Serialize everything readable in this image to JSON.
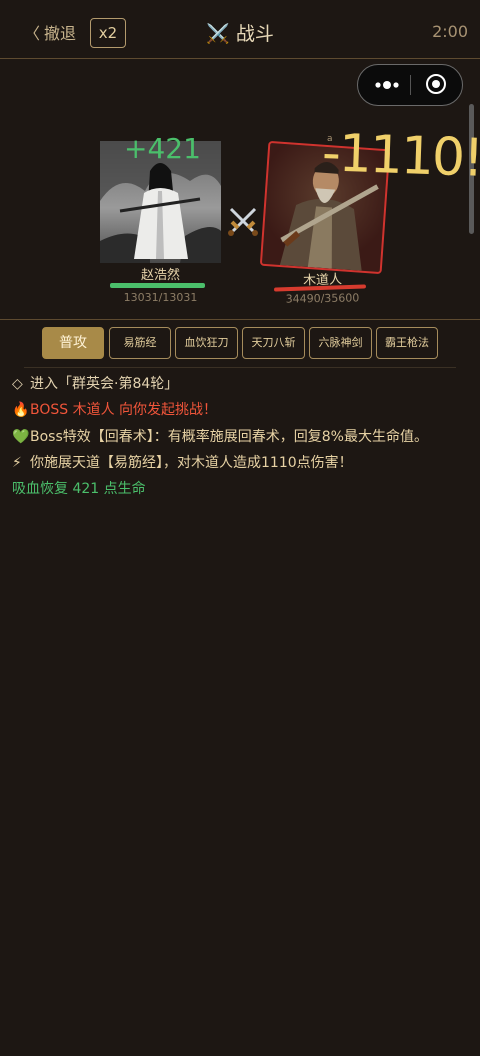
{
  "header": {
    "retreat_chevron": "〈",
    "retreat_label": "撤退",
    "speed_label": "x2",
    "title_icon": "⚔️",
    "title": "战斗",
    "timer": "2:00"
  },
  "capsule": {
    "more_icon": "more-dots-icon",
    "close_icon": "record-icon"
  },
  "battle": {
    "hero": {
      "name": "赵浩然",
      "hp": "13031/13031",
      "hp_fraction": 1.0,
      "heal_popup": "+421"
    },
    "boss": {
      "name": "木道人",
      "hp": "34490/35600",
      "hp_fraction": 0.969,
      "damage_popup": "-1110!",
      "popup_mark": "a"
    },
    "vs_icon": "⚔️"
  },
  "skills": [
    {
      "label": "普攻",
      "active": true
    },
    {
      "label": "易筋经",
      "active": false
    },
    {
      "label": "血饮狂刀",
      "active": false
    },
    {
      "label": "天刀八斩",
      "active": false
    },
    {
      "label": "六脉神剑",
      "active": false
    },
    {
      "label": "霸王枪法",
      "active": false
    }
  ],
  "log": [
    {
      "icon": "◇",
      "text": "进入「群英会·第84轮」",
      "color": "#e2d2b0"
    },
    {
      "icon": "🔥",
      "text": "BOSS 木道人 向你发起挑战！",
      "color": "#f0553a"
    },
    {
      "icon": "💚",
      "text": "Boss特效【回春术】：有概率施展回春术，回复8%最大生命值。",
      "color": "#e7d2a4"
    },
    {
      "icon": "⚡",
      "text": "你施展天道【易筋经】，对木道人造成1110点伤害！",
      "color": "#e7d2a4"
    },
    {
      "icon": "",
      "text": "吸血恢复 421 点生命",
      "color": "#4bbf6b"
    }
  ],
  "colors": {
    "accent": "#a88a48",
    "heal": "#4bbf6b",
    "damage": "#f0d06a",
    "boss_border": "#d0332e"
  }
}
